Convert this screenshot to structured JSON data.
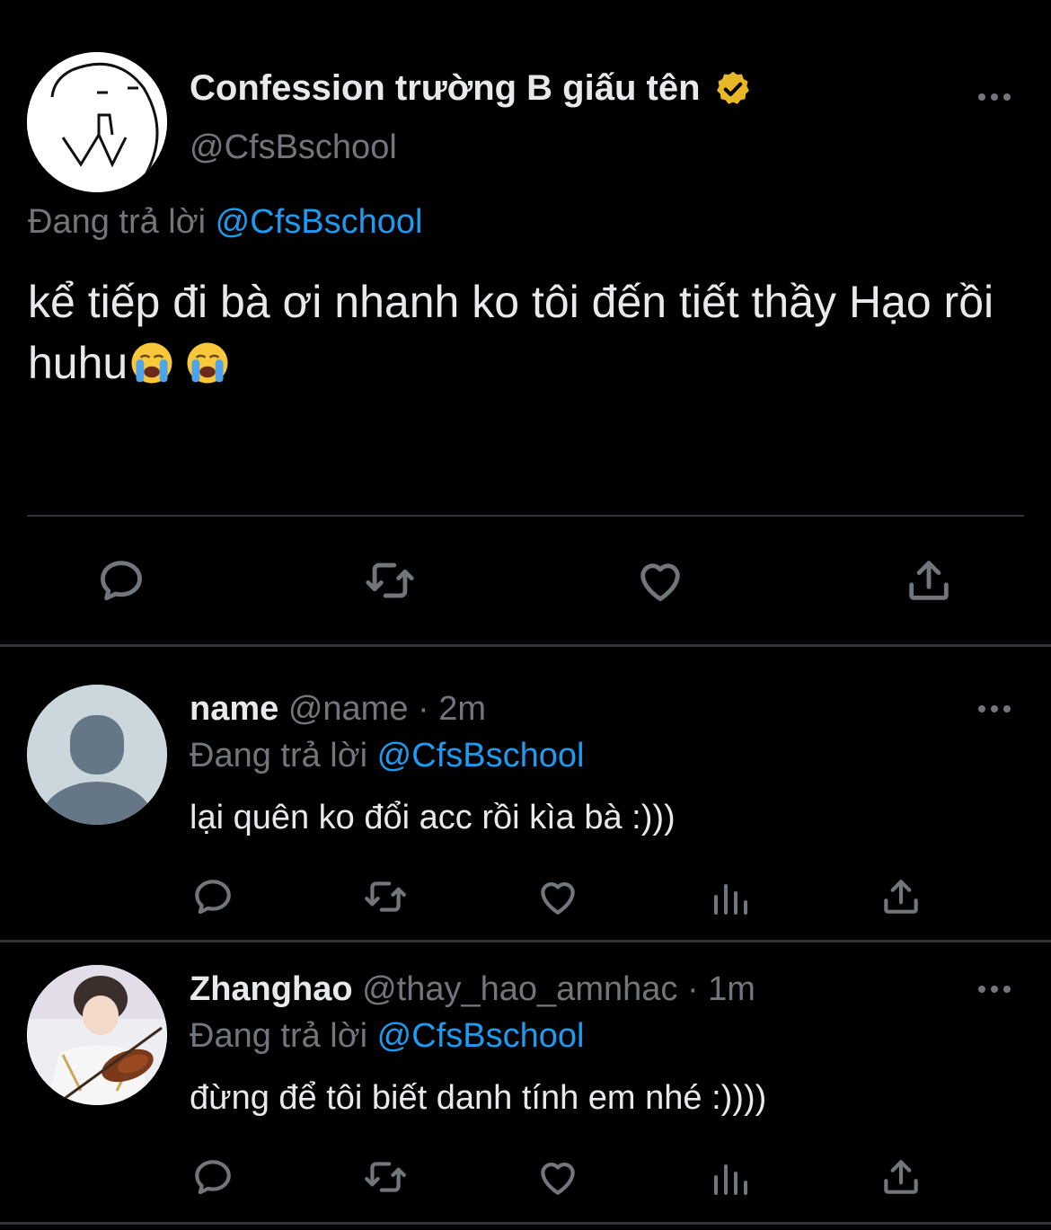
{
  "main_tweet": {
    "display_name": "Confession trường B giấu tên",
    "handle": "@CfsBschool",
    "replying_prefix": "Đang trả lời",
    "replying_to": "@CfsBschool",
    "text": "kể tiếp đi bà ơi nhanh ko tôi đến tiết thầy Hạo rồi huhu",
    "emojis": [
      "loudly-crying-face",
      "loudly-crying-face"
    ],
    "actions": [
      "reply-icon",
      "retweet-icon",
      "like-icon",
      "share-icon"
    ]
  },
  "replies": [
    {
      "display_name": "name",
      "handle": "@name",
      "separator": "·",
      "time": "2m",
      "replying_prefix": "Đang trả lời",
      "replying_to": "@CfsBschool",
      "text": "lại quên ko đổi acc rồi kìa bà :)))",
      "actions": [
        "reply-icon",
        "retweet-icon",
        "like-icon",
        "analytics-icon",
        "share-icon"
      ]
    },
    {
      "display_name": "Zhanghao",
      "handle": "@thay_hao_amnhac",
      "separator": "·",
      "time": "1m",
      "replying_prefix": "Đang trả lời",
      "replying_to": "@CfsBschool",
      "text": "đừng để tôi biết danh tính em nhé :))))",
      "actions": [
        "reply-icon",
        "retweet-icon",
        "like-icon",
        "analytics-icon",
        "share-icon"
      ]
    }
  ],
  "colors": {
    "background": "#000000",
    "text": "#e7e9ea",
    "muted": "#71767b",
    "link": "#1d9bf0",
    "verified": "#e8b829",
    "divider": "#2f3336"
  }
}
